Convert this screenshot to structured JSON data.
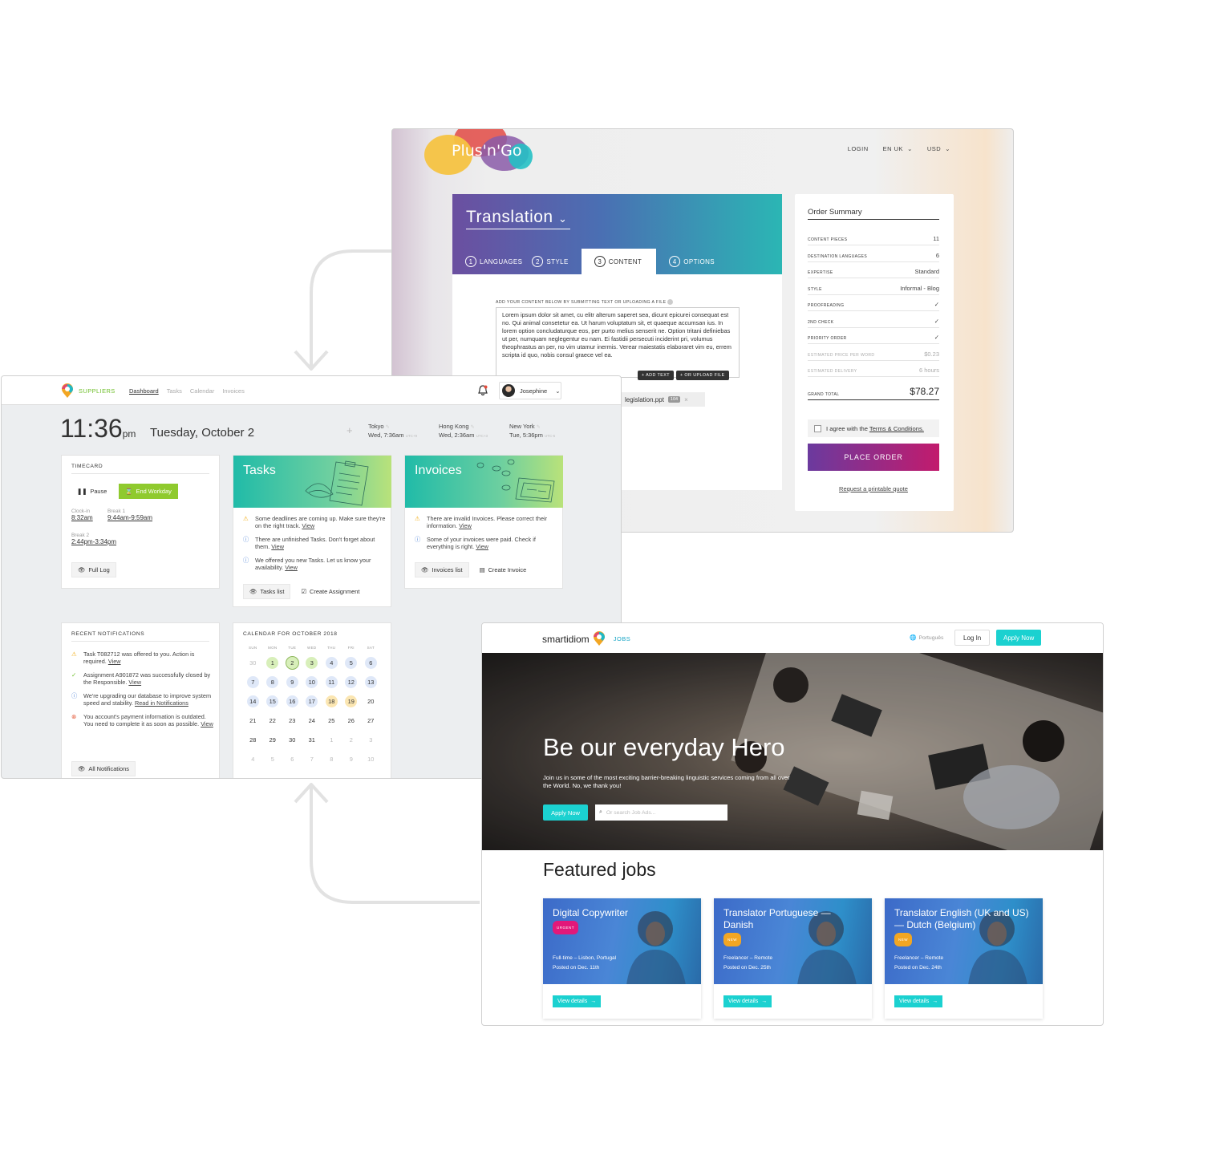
{
  "plusngo": {
    "logo": "Plus'n'Go",
    "nav": {
      "login": "LOGIN",
      "lang": "EN UK",
      "currency": "USD"
    },
    "service": "Translation",
    "steps": [
      {
        "num": "1",
        "label": "LANGUAGES"
      },
      {
        "num": "2",
        "label": "STYLE"
      },
      {
        "num": "3",
        "label": "CONTENT"
      },
      {
        "num": "4",
        "label": "OPTIONS"
      }
    ],
    "active_step": "CONTENT",
    "content_label": "ADD YOUR CONTENT BELOW BY SUBMITTING TEXT OR UPLOADING A FILE",
    "content_text": "Lorem ipsum dolor sit amet, cu elitr alterum saperet sea, dicunt epicurei consequat est no. Qui animal consetetur ea. Ut harum voluptatum sit, et quaeque accumsan ius. In lorem option concludaturque eos, per purto melius senserit ne. Option tritani definiebas ut per, numquam neglegentur eu nam. Ei fastidii persecuti inciderint pri, volumus theophrastus an per, no vim utamur inermis. Verear maiestatis elaboraret vim eu, errem scripta id quo, nobis consul graece vel ea.",
    "add_text": "ADD TEXT",
    "upload_file": "OR UPLOAD FILE",
    "file": {
      "name": "legislation.ppt",
      "size": "104"
    },
    "summary": {
      "title": "Order Summary",
      "rows": [
        {
          "key": "CONTENT PIECES",
          "value": "11"
        },
        {
          "key": "DESTINATION LANGUAGES",
          "value": "6"
        },
        {
          "key": "EXPERTISE",
          "value": "Standard"
        },
        {
          "key": "STYLE",
          "value": "Informal - Blog"
        },
        {
          "key": "PROOFREADING",
          "value": "✓"
        },
        {
          "key": "2ND CHECK",
          "value": "✓"
        },
        {
          "key": "PRIORITY ORDER",
          "value": "✓"
        },
        {
          "key": "ESTIMATED PRICE PER WORD",
          "value": "$0.23"
        },
        {
          "key": "ESTIMATED DELIVERY",
          "value": "6 hours"
        }
      ],
      "grand_total_label": "GRAND TOTAL",
      "grand_total": "$78.27",
      "agree_prefix": "I agree with the",
      "agree_link": "Terms & Conditions.",
      "place_order": "PLACE ORDER",
      "quote": "Request a printable quote"
    }
  },
  "suppliers": {
    "brand": "SUPPLIERS",
    "nav": [
      "Dashboard",
      "Tasks",
      "Calendar",
      "Invoices"
    ],
    "user": "Josephine",
    "time": "11:36",
    "ampm": "pm",
    "date": "Tuesday, October 2",
    "timezones": [
      {
        "city": "Tokyo",
        "time": "Wed, 7:36am",
        "utc": "UTC+9"
      },
      {
        "city": "Hong Kong",
        "time": "Wed, 2:36am",
        "utc": "UTC+3"
      },
      {
        "city": "New York",
        "time": "Tue, 5:36pm",
        "utc": "UTC-5"
      }
    ],
    "timecard": {
      "title": "TIMECARD",
      "pause": "Pause",
      "end": "End Workday",
      "clockin_label": "Clock-in",
      "clockin": "8:32am",
      "break1_label": "Break 1",
      "break1": "9:44am-9:59am",
      "break2_label": "Break 2",
      "break2": "2:44pm-3:34pm",
      "full_log": "Full Log"
    },
    "tasks": {
      "title": "Tasks",
      "notes": [
        {
          "text": "Some deadlines are coming up. Make sure they're on the right track.",
          "link": "View"
        },
        {
          "text": "There are unfinished Tasks. Don't forget about them.",
          "link": "View"
        },
        {
          "text": "We offered you new Tasks. Let us know your availability.",
          "link": "View"
        }
      ],
      "list_btn": "Tasks list",
      "create_btn": "Create Assignment"
    },
    "invoices": {
      "title": "Invoices",
      "notes": [
        {
          "text": "There are invalid Invoices. Please correct their information.",
          "link": "View"
        },
        {
          "text": "Some of your invoices were paid. Check if everything is right.",
          "link": "View"
        }
      ],
      "list_btn": "Invoices list",
      "create_btn": "Create Invoice"
    },
    "notifications": {
      "title": "RECENT NOTIFICATIONS",
      "items": [
        {
          "text": "Task T082712 was offered to you. Action is required.",
          "link": "View"
        },
        {
          "text": "Assignment A901872 was successfully closed by the Responsible.",
          "link": "View"
        },
        {
          "text": "We're upgrading our database to improve system speed and stability.",
          "link": "Read in Notifications"
        },
        {
          "text": "You account's payment information is outdated. You need to complete it as soon as possible.",
          "link": "View"
        }
      ],
      "all_btn": "All Notifications"
    },
    "calendar": {
      "title": "CALENDAR FOR OCTOBER 2018",
      "days": [
        "SUN",
        "MON",
        "TUE",
        "WED",
        "THU",
        "FRI",
        "SAT"
      ],
      "weeks": [
        [
          "30",
          "1",
          "2",
          "3",
          "4",
          "5",
          "6"
        ],
        [
          "7",
          "8",
          "9",
          "10",
          "11",
          "12",
          "13"
        ],
        [
          "14",
          "15",
          "16",
          "17",
          "18",
          "19",
          "20"
        ],
        [
          "21",
          "22",
          "23",
          "24",
          "25",
          "26",
          "27"
        ],
        [
          "28",
          "29",
          "30",
          "31",
          "1",
          "2",
          "3"
        ],
        [
          "4",
          "5",
          "6",
          "7",
          "8",
          "9",
          "10"
        ]
      ],
      "colors": {
        "green": "#d8efba",
        "blue": "#dfe8f8",
        "yellow": "#fbe6b2"
      }
    }
  },
  "jobs": {
    "logo": "smartidiom",
    "section": "JOBS",
    "language": "Português",
    "login": "Log In",
    "apply": "Apply Now",
    "headline": "Be our everyday Hero",
    "subline": "Join us in some of the most exciting barrier-breaking linguistic services coming from all over the World. No, we thank you!",
    "hero_apply": "Apply Now",
    "search_placeholder": "Or search Job Ads...",
    "featured": "Featured jobs",
    "cards": [
      {
        "title": "Digital Copywriter",
        "badge": "URGENT",
        "type": "Full-time – Lisbon, Portugal",
        "posted": "Posted on Dec. 11th",
        "cta": "View details"
      },
      {
        "title": "Translator Portuguese — Danish",
        "badge": "NEW",
        "type": "Freelancer – Remote",
        "posted": "Posted on Dec. 25th",
        "cta": "View details"
      },
      {
        "title": "Translator English (UK and US) — Dutch (Belgium)",
        "badge": "NEW",
        "type": "Freelancer – Remote",
        "posted": "Posted on Dec. 24th",
        "cta": "View details"
      }
    ]
  }
}
